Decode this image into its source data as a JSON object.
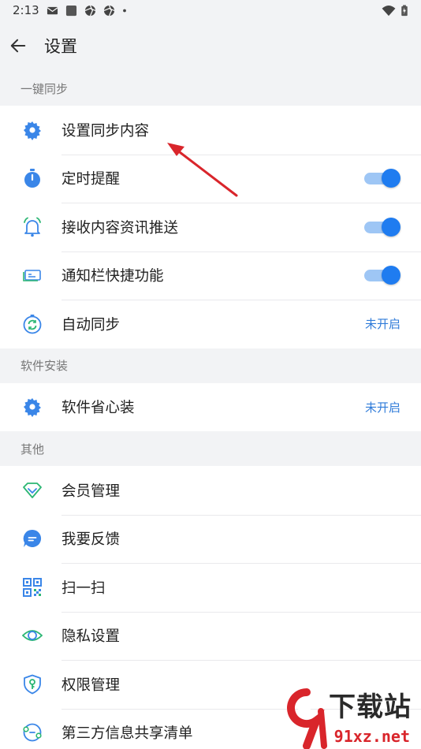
{
  "status_bar": {
    "time": "2:13"
  },
  "header": {
    "title": "设置"
  },
  "sections": [
    {
      "title": "一键同步",
      "items": [
        {
          "label": "设置同步内容",
          "icon": "gear-icon"
        },
        {
          "label": "定时提醒",
          "icon": "stopwatch-icon",
          "toggle": true
        },
        {
          "label": "接收内容资讯推送",
          "icon": "bell-icon",
          "toggle": true
        },
        {
          "label": "通知栏快捷功能",
          "icon": "card-icon",
          "toggle": true
        },
        {
          "label": "自动同步",
          "icon": "sync-icon",
          "status": "未开启"
        }
      ]
    },
    {
      "title": "软件安装",
      "items": [
        {
          "label": "软件省心装",
          "icon": "gear-icon",
          "status": "未开启"
        }
      ]
    },
    {
      "title": "其他",
      "items": [
        {
          "label": "会员管理",
          "icon": "diamond-icon"
        },
        {
          "label": "我要反馈",
          "icon": "chat-bubble-icon"
        },
        {
          "label": "扫一扫",
          "icon": "qr-code-icon"
        },
        {
          "label": "隐私设置",
          "icon": "eye-icon"
        },
        {
          "label": "权限管理",
          "icon": "shield-key-icon"
        },
        {
          "label": "第三方信息共享清单",
          "icon": "share-list-icon"
        }
      ]
    }
  ],
  "watermark": {
    "text": "下载站",
    "domain": "91xz.net"
  },
  "colors": {
    "accent": "#1f7cf0",
    "toggle_track": "#9ec6f5",
    "status_text": "#2f7bd9",
    "icon_green": "#2bb673",
    "icon_blue": "#3a86e8",
    "annotation_arrow": "#d9252b"
  }
}
